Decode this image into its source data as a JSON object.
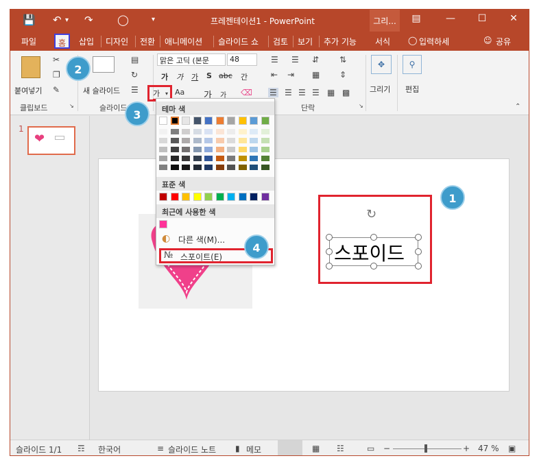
{
  "titlebar": {
    "title": "프레젠테이션1 - PowerPoint",
    "context_tab": "그리...",
    "icons": [
      "save-icon",
      "undo-icon",
      "redo-icon",
      "touch-mode-icon",
      "customize-icon"
    ],
    "window_buttons": [
      "ribbon-display-icon",
      "minimize-icon",
      "maximize-icon",
      "close-icon"
    ]
  },
  "tabs": [
    {
      "label": "파일"
    },
    {
      "label": "홈"
    },
    {
      "label": "삽입"
    },
    {
      "label": "디자인"
    },
    {
      "label": "전환"
    },
    {
      "label": "애니메이션"
    },
    {
      "label": "슬라이드 쇼"
    },
    {
      "label": "검토"
    },
    {
      "label": "보기"
    },
    {
      "label": "추가 기능"
    },
    {
      "label": "서식"
    }
  ],
  "tellme": "입력하세",
  "share": "공유",
  "ribbon": {
    "paste": "붙여넣기",
    "new_slide": "새 슬라이드",
    "font_name": "맑은 고딕 (본문",
    "font_size": "48",
    "font_color_btn": "가",
    "bold": "가",
    "italic": "가",
    "underline": "가",
    "shadow": "S",
    "strike": "abc",
    "spacing": "간",
    "case": "Aa",
    "grow": "가",
    "shrink": "가",
    "draw": "그리기",
    "edit": "편집",
    "groups": {
      "clipboard": "클립보드",
      "slides": "슬라이드",
      "paragraph": "단락"
    }
  },
  "dropdown": {
    "theme_colors": "테마 색",
    "standard_colors": "표준 색",
    "recent_colors": "최근에 사용한 색",
    "more_colors": "다른 색(M)...",
    "eyedropper": "스포이트(E)",
    "theme_top": [
      "#ffffff",
      "#000000",
      "#e7e6e6",
      "#44546a",
      "#4472c4",
      "#ed7d31",
      "#a5a5a5",
      "#ffc000",
      "#5b9bd5",
      "#70ad47"
    ],
    "standard": [
      "#c00000",
      "#ff0000",
      "#ffc000",
      "#ffff00",
      "#92d050",
      "#00b050",
      "#00b0f0",
      "#0070c0",
      "#002060",
      "#7030a0"
    ],
    "recent": [
      "#ff3399"
    ]
  },
  "slide": {
    "text": "스포이드",
    "thumb_number": "1"
  },
  "callouts": [
    "1",
    "2",
    "3",
    "4"
  ],
  "statusbar": {
    "slide_info": "슬라이드 1/1",
    "language": "한국어",
    "notes": "슬라이드 노트",
    "comments": "메모",
    "zoom": "47 %"
  }
}
